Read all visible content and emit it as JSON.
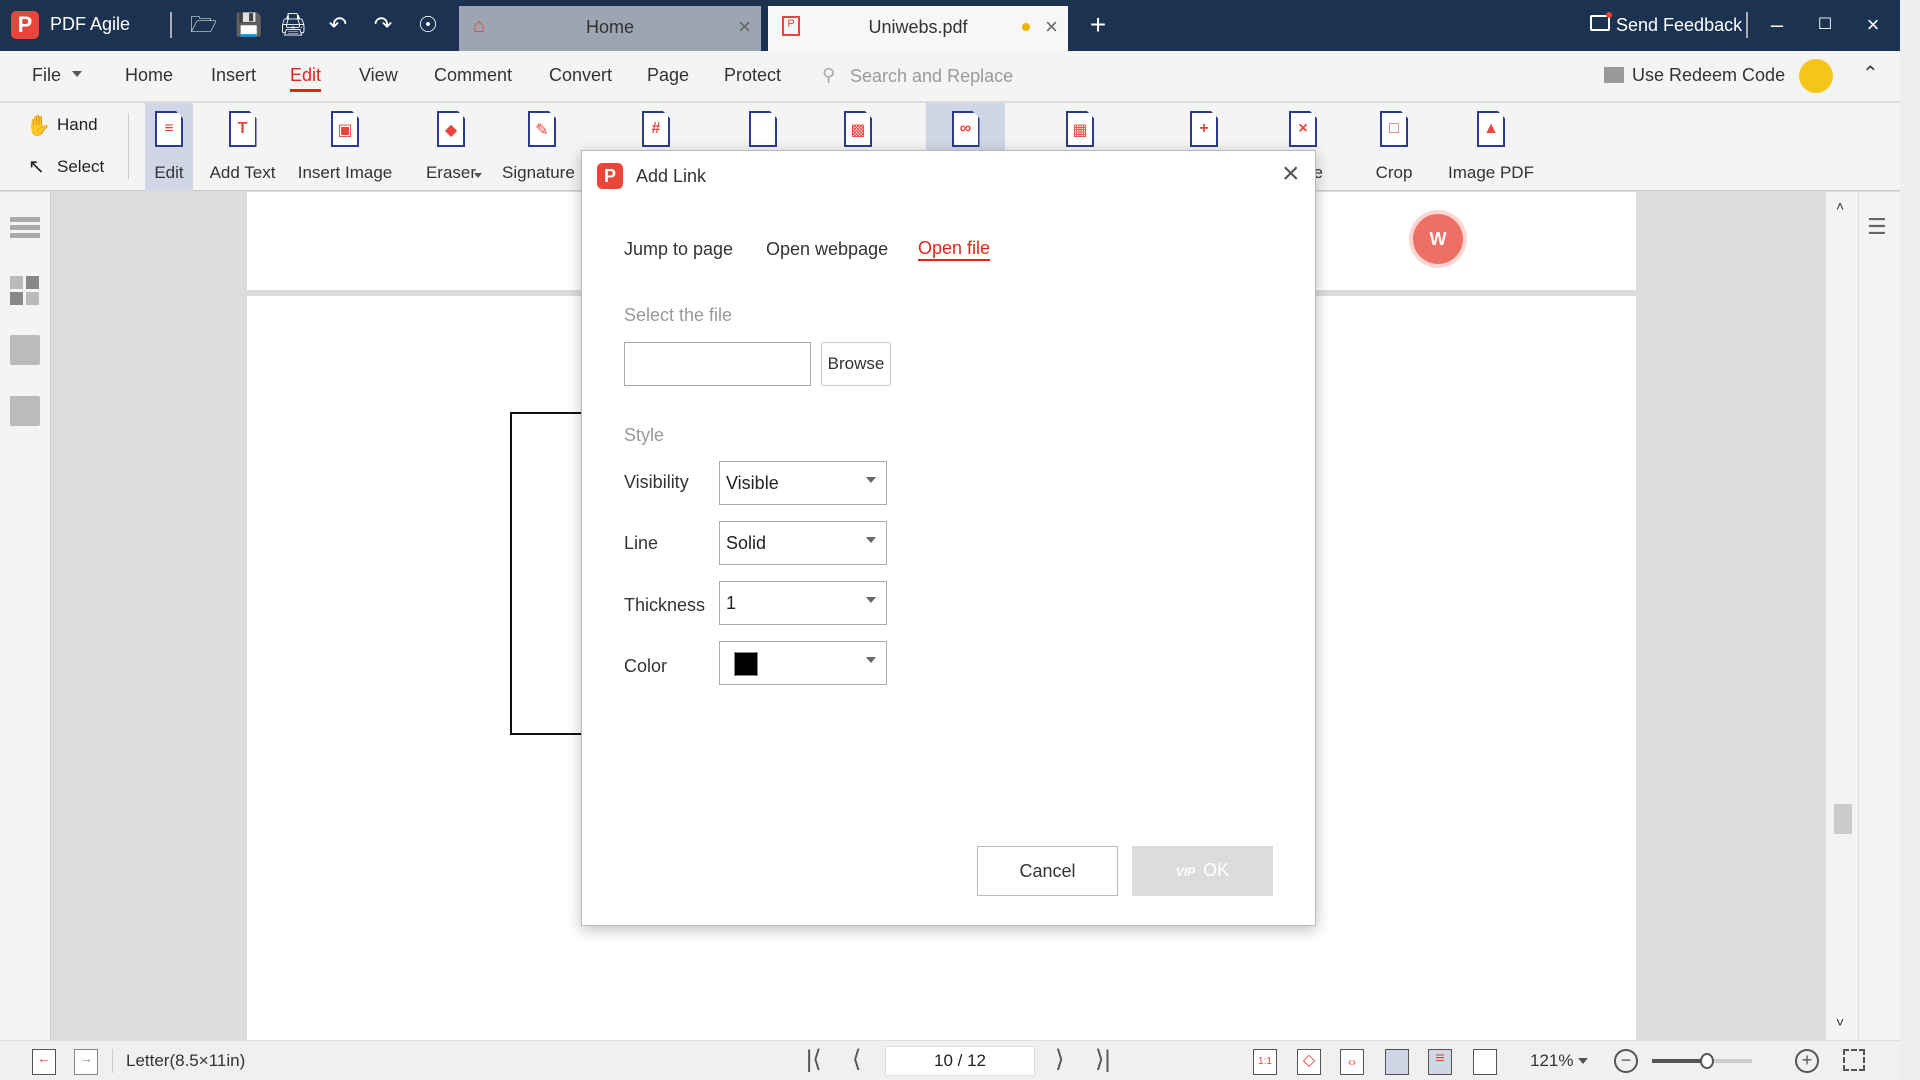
{
  "app": {
    "name": "PDF Agile",
    "send_feedback": "Send Feedback",
    "redeem": "Use Redeem Code"
  },
  "tabs": [
    {
      "label": "Home",
      "active": false
    },
    {
      "label": "Uniwebs.pdf",
      "active": true,
      "unsaved": true
    }
  ],
  "menu": {
    "items": [
      "File",
      "Home",
      "Insert",
      "Edit",
      "View",
      "Comment",
      "Convert",
      "Page",
      "Protect"
    ],
    "active": "Edit",
    "search_placeholder": "Search and Replace"
  },
  "toolbar": {
    "hand": "Hand",
    "select": "Select",
    "tools": [
      {
        "label": "Edit",
        "icon": "edit-icon",
        "active": true
      },
      {
        "label": "Add Text",
        "icon": "text-icon"
      },
      {
        "label": "Insert Image",
        "icon": "image-icon"
      },
      {
        "label": "Eraser",
        "icon": "eraser-icon",
        "dropdown": true
      },
      {
        "label": "Signature",
        "icon": "signature-icon",
        "dropdown": true
      },
      {
        "label": "",
        "icon": "header-footer-icon"
      },
      {
        "label": "",
        "icon": "page-size-icon"
      },
      {
        "label": "",
        "icon": "watermark-icon"
      },
      {
        "label": "",
        "icon": "link-icon",
        "active": true
      },
      {
        "label": "",
        "icon": "organize-icon"
      },
      {
        "label": "",
        "icon": "insert-page-icon"
      },
      {
        "label": "e",
        "icon": "delete-page-icon"
      },
      {
        "label": "Crop",
        "icon": "crop-icon"
      },
      {
        "label": "Image PDF",
        "icon": "image-pdf-icon"
      }
    ]
  },
  "dialog": {
    "title": "Add Link",
    "tabs": [
      "Jump to page",
      "Open webpage",
      "Open file"
    ],
    "active_tab": "Open file",
    "select_file_label": "Select the file",
    "file_value": "",
    "browse": "Browse",
    "style_label": "Style",
    "visibility_label": "Visibility",
    "visibility_value": "Visible",
    "line_label": "Line",
    "line_value": "Solid",
    "thickness_label": "Thickness",
    "thickness_value": "1",
    "color_label": "Color",
    "color_value": "#000000",
    "cancel": "Cancel",
    "ok": "OK",
    "ok_badge": "VIP"
  },
  "status": {
    "page_size": "Letter(8.5×11in)",
    "page_indicator": "10 / 12",
    "zoom": "121%",
    "zoom_level_fraction": 0.55
  },
  "colors": {
    "brand": "#e8453c",
    "titlebar": "#1b3250",
    "accent": "#e0251b"
  }
}
